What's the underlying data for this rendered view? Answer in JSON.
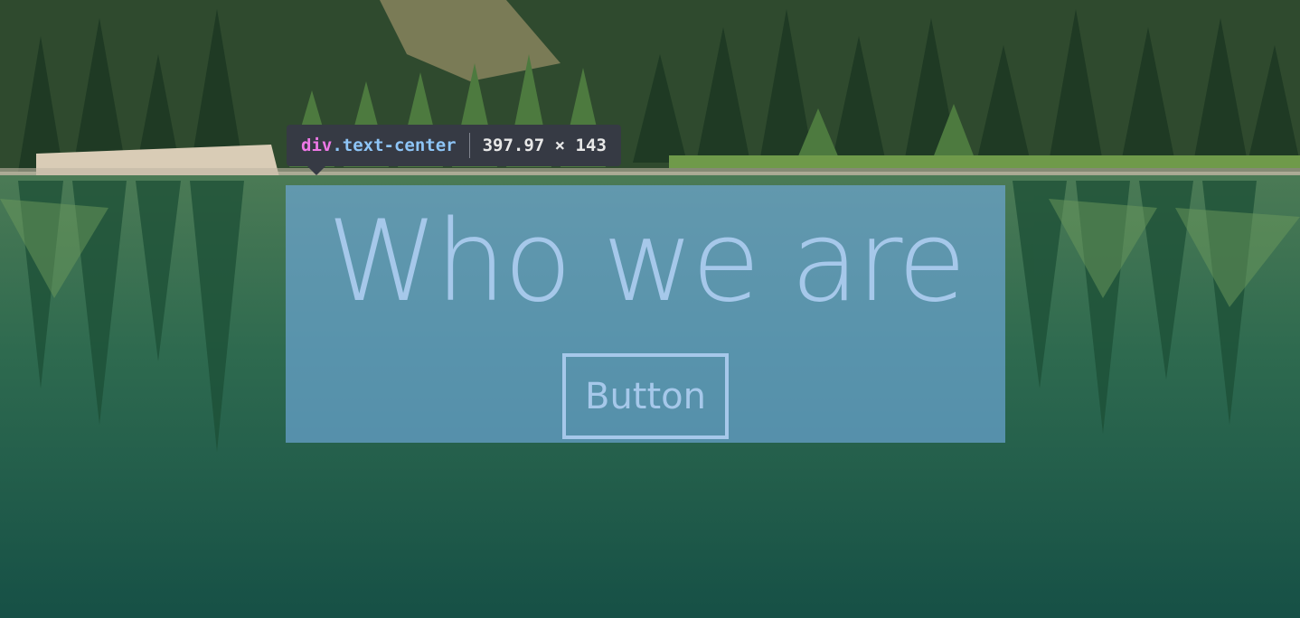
{
  "hero": {
    "headline": "Who we are",
    "button_label": "Button"
  },
  "inspector_tooltip": {
    "tag": "div",
    "class_name": ".text-center",
    "dimensions": "397.97 × 143"
  },
  "colors": {
    "highlight_overlay": "#6fa8dc",
    "headline_text": "#a6c8ea",
    "tooltip_bg": "#363a44",
    "tooltip_tag": "#ee78e6",
    "tooltip_class": "#8ec5f7"
  }
}
